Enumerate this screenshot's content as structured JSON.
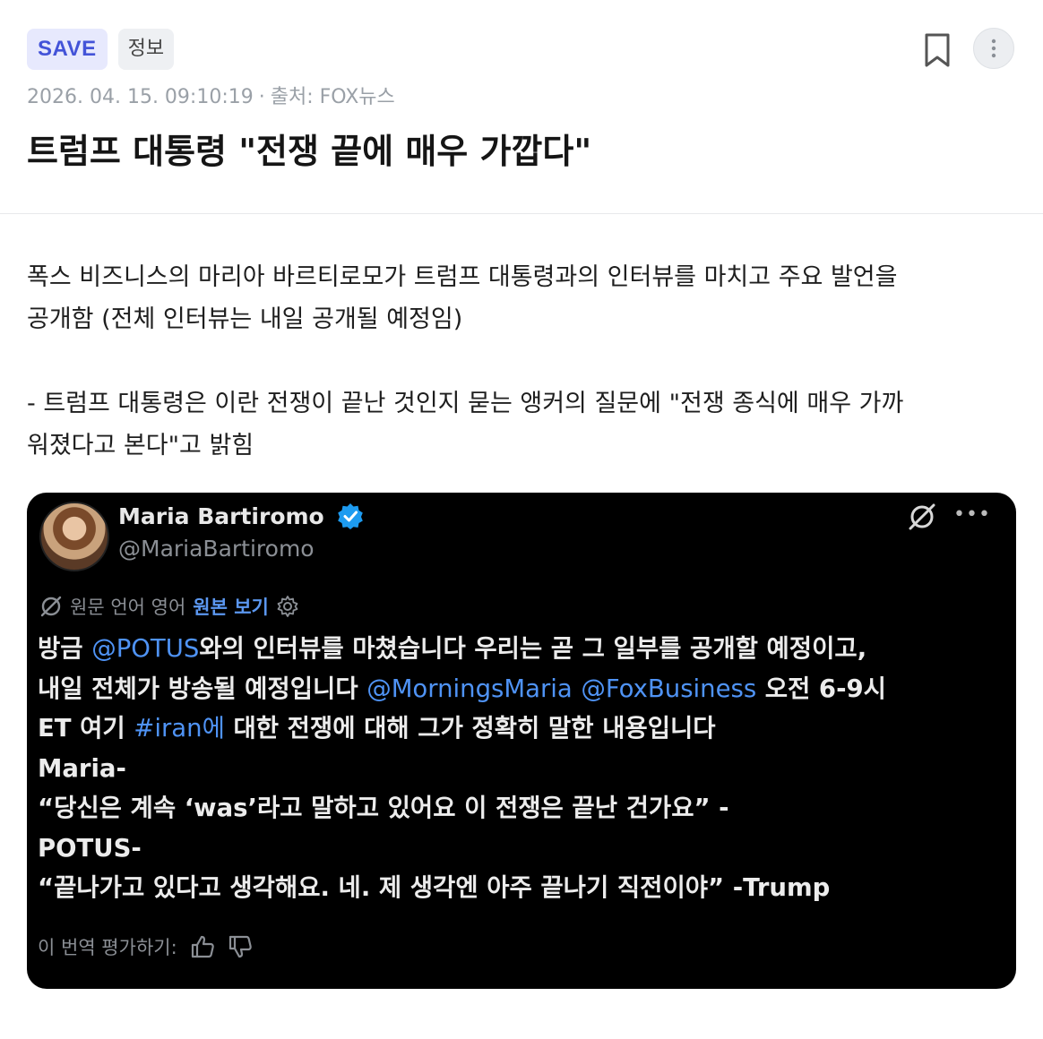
{
  "header": {
    "save_badge": "SAVE",
    "info_badge": "정보",
    "datetime": "2026. 04. 15. 09:10:19",
    "source": "출처: FOX뉴스",
    "title": "트럼프 대통령 \"전쟁 끝에 매우 가깝다\""
  },
  "body": {
    "paragraph1_line1": "폭스 비즈니스의 마리아 바르티로모가 트럼프 대통령과의 인터뷰를 마치고 주요 발언을",
    "paragraph1_line2": "공개함 (전체 인터뷰는 내일 공개될 예정임)",
    "paragraph2_line1": "- 트럼프 대통령은 이란 전쟁이 끝난 것인지 묻는 앵커의 질문에 \"전쟁 종식에 매우 가까",
    "paragraph2_line2": "워졌다고 본다\"고 밝힘"
  },
  "tweet": {
    "author_name": "Maria Bartiromo",
    "handle": "@MariaBartiromo",
    "translation_note": "원문 언어 영어",
    "show_original": "원본 보기",
    "line1_a": "방금 ",
    "line1_link": "@POTUS",
    "line1_b": "와의 인터뷰를 마쳤습니다 우리는 곧 그 일부를 공개할 예정이고,",
    "line2_a": "내일 전체가 방송될 예정입니다 ",
    "line2_link1": "@MorningsMaria",
    "line2_link2": "@FoxBusiness",
    "line2_b": " 오전 6-9시",
    "line3_a": "ET 여기 ",
    "line3_link": "#iran에",
    "line3_b": " 대한 전쟁에 대해 그가 정확히 말한 내용입니다",
    "line4": "Maria-",
    "line5": "“당신은 계속 ‘was’라고 말하고 있어요 이 전쟁은 끝난 건가요” -",
    "line6": "POTUS-",
    "line7": "“끝나가고 있다고 생각해요. 네. 제 생각엔 아주 끝나기 직전이야” -Trump",
    "rate_label": "이 번역 평가하기:"
  },
  "colors": {
    "save_badge_text": "#4353d8",
    "save_badge_bg": "#e7e9fd",
    "link_blue": "#4f93f5",
    "verified_blue": "#1d9bf0",
    "tweet_bg": "#000000"
  },
  "icons": [
    "bookmark-icon",
    "more-vertical-icon",
    "verified-badge-icon",
    "grok-icon",
    "more-horizontal-icon",
    "translate-icon",
    "settings-gear-icon",
    "thumbs-up-icon",
    "thumbs-down-icon"
  ]
}
